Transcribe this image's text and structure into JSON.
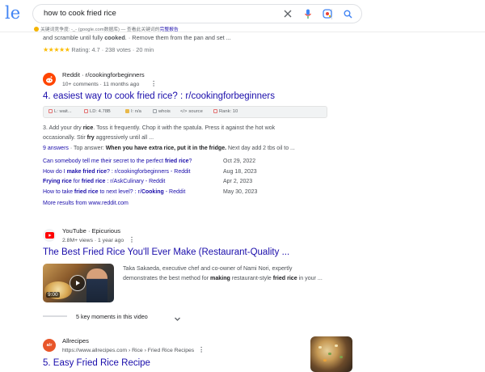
{
  "header": {
    "logo": "le",
    "search_value": "how to cook fried rice",
    "keyword_note": "关键词竞争度: -_- (google.com数据库) — 查看此关键词的",
    "keyword_link": "完整报告"
  },
  "prev_result": {
    "snippet_pre": "and scramble until fully ",
    "snippet_bold": "cooked",
    "snippet_post": ". · Remove them from the pan and set ...",
    "stars": "★★★★★",
    "rating": "Rating: 4.7 · 238 votes · 20 min"
  },
  "result4": {
    "site": "Reddit · r/cookingforbeginners",
    "meta": "10+ comments · 11 months ago",
    "title": "4. easiest way to cook fried rice? : r/cookingforbeginners",
    "seo": {
      "l": "L: wait...",
      "ld": "LD: 4.78B",
      "i": "I: n/a",
      "whois": "whois",
      "source": "source",
      "rank": "Rank: 10"
    },
    "snippet1_a": "3. Add your dry ",
    "snippet1_b": "rice",
    "snippet1_c": ". Toss it frequently. Chop it with the spatula. Press it against the hot wok",
    "snippet2_a": "occasionally. Stir ",
    "snippet2_b": "fry",
    "snippet2_c": " aggressively until all ...",
    "answers_link": "9 answers",
    "answers_pre": " · Top answer: ",
    "answers_bold": "When you have extra rice, put it in the fridge.",
    "answers_post": " Next day add 2 tbs oil to ...",
    "sublinks": [
      {
        "a": "Can somebody tell me their secret to the perfect ",
        "b": "fried rice",
        "c": "?",
        "date": "Oct 29, 2022"
      },
      {
        "a": "How do I ",
        "b": "make fried rice",
        "c": "? : r/cookingforbeginners - Reddit",
        "date": "Aug 18, 2023"
      },
      {
        "a": "",
        "b": "Frying rice",
        "c": " for ",
        "d": "fried rice",
        "e": " : r/AskCulinary - Reddit",
        "date": "Apr 2, 2023"
      },
      {
        "a": "How to take ",
        "b": "fried rice",
        "c": " to next level? : r/",
        "d": "Cooking",
        "e": " - Reddit",
        "date": "May 30, 2023"
      }
    ],
    "more_results": "More results from www.reddit.com"
  },
  "video_result": {
    "site": "YouTube · Epicurious",
    "meta": "2.8M+ views · 1 year ago",
    "title": "The Best Fried Rice You'll Ever Make (Restaurant-Quality ...",
    "duration": "9:00",
    "desc_line1": "Taka Sakaeda, executive chef and co-owner of Nami Nori, expertly",
    "desc_a": "demonstrates the best method for ",
    "desc_b": "making",
    "desc_c": " restaurant-style ",
    "desc_d": "fried rice",
    "desc_e": " in your ...",
    "key_moments": "5 key moments in this video"
  },
  "result5": {
    "site": "Allrecipes",
    "url": "https://www.allrecipes.com › Rice › Fried Rice Recipes",
    "title": "5. Easy Fried Rice Recipe",
    "favicon_text": "a/r"
  },
  "colors": {
    "link": "#1a0dab",
    "reddit": "#ff4500",
    "youtube": "#ff0000",
    "allrecipes": "#e8562a"
  },
  "icons": [
    "clear-icon",
    "mic-icon",
    "lens-icon",
    "search-icon",
    "reddit-icon",
    "youtube-icon",
    "allrecipes-icon",
    "play-icon",
    "chevron-down-icon",
    "more-dots-icon"
  ]
}
